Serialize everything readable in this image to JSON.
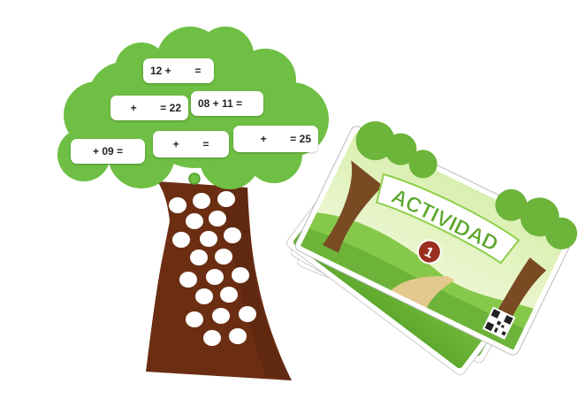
{
  "tree": {
    "equations": [
      "12 +        =",
      "+        = 22",
      "08 + 11 =",
      "+ 09 =",
      "+        =",
      "+        = 25"
    ]
  },
  "card": {
    "title": "ACTIVIDAD",
    "number": "1"
  },
  "colors": {
    "canopy": "#6fbf44",
    "canopy_edge": "#4f9a2c",
    "trunk": "#6b2e12",
    "card_sky": "#e7f3c4",
    "badge": "#9b2e1f"
  }
}
